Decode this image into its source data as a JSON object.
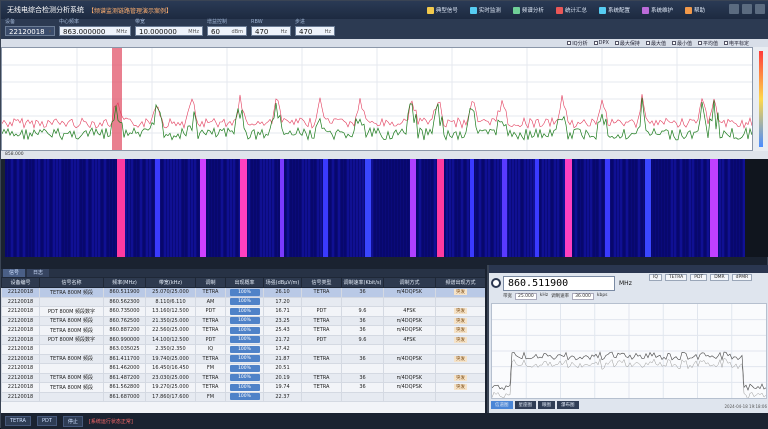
{
  "title": {
    "app_name": "无线电综合检测分析系统",
    "subtitle": "【频谱监测链路管理演示案例】"
  },
  "topnav": [
    {
      "label": "典型信号",
      "color": "#f2c94c"
    },
    {
      "label": "实时监测",
      "color": "#56ccf2"
    },
    {
      "label": "频谱分析",
      "color": "#6fcf97"
    },
    {
      "label": "统计汇总",
      "color": "#eb5757"
    },
    {
      "label": "系统配置",
      "color": "#56ccf2"
    },
    {
      "label": "系统维护",
      "color": "#bb6bd9"
    },
    {
      "label": "帮助",
      "color": "#f2994a"
    }
  ],
  "params": [
    {
      "label": "设备",
      "value": "22120018",
      "unit": ""
    },
    {
      "label": "中心频率",
      "value": "863.000000",
      "unit": "MHz"
    },
    {
      "label": "带宽",
      "value": "10.000000",
      "unit": "MHz"
    },
    {
      "label": "增益控制",
      "value": "60",
      "unit": "dBm"
    },
    {
      "label": "RBW",
      "value": "470",
      "unit": "Hz"
    },
    {
      "label": "步进",
      "value": "470",
      "unit": "Hz"
    }
  ],
  "spectrum_toolbar": [
    "IQ分析",
    "DPX",
    "最大保持",
    "最大值",
    "最小值",
    "平均值",
    "电平标定"
  ],
  "spectrum_foot": "858.000",
  "spectrum_marker": "860.511",
  "bottom_tabs": [
    "信号",
    "日志"
  ],
  "table": {
    "columns": [
      "设备编号",
      "信号名称",
      "频率(MHz)",
      "带宽(kHz)",
      "调制",
      "出现概率",
      "场强(dBμV/m)",
      "信号类型",
      "调制速率(Kbit/s)",
      "调制方式",
      "频谱出现方式"
    ],
    "rows": [
      [
        "22120018",
        "TETRA 800M 频段",
        "860.511900",
        "25.070/25.000",
        "TETRA",
        "100%",
        "26.10",
        "TETRA",
        "36",
        "π/4DQPSK",
        "突发"
      ],
      [
        "22120018",
        "",
        "860.562300",
        "8.110/6.110",
        "AM",
        "100%",
        "17.20",
        "",
        "",
        "",
        ""
      ],
      [
        "22120018",
        "PDT 800M 频段数字",
        "860.735000",
        "13.160/12.500",
        "PDT",
        "100%",
        "16.71",
        "PDT",
        "9.6",
        "4FSK",
        "突发"
      ],
      [
        "22120018",
        "TETRA 800M 频段",
        "860.762500",
        "21.350/25.000",
        "TETRA",
        "100%",
        "23.25",
        "TETRA",
        "36",
        "π/4DQPSK",
        "突发"
      ],
      [
        "22120018",
        "TETRA 800M 频段",
        "860.887200",
        "22.560/25.000",
        "TETRA",
        "100%",
        "25.43",
        "TETRA",
        "36",
        "π/4DQPSK",
        "突发"
      ],
      [
        "22120018",
        "PDT 800M 频段数字",
        "860.990000",
        "14.100/12.500",
        "PDT",
        "100%",
        "21.72",
        "PDT",
        "9.6",
        "4FSK",
        "突发"
      ],
      [
        "22120018",
        "",
        "863.035025",
        "2.350/2.350",
        "IQ",
        "100%",
        "17.42",
        "",
        "",
        "",
        ""
      ],
      [
        "22120018",
        "TETRA 800M 频段",
        "861.411700",
        "19.740/25.000",
        "TETRA",
        "100%",
        "21.87",
        "TETRA",
        "36",
        "π/4DQPSK",
        "突发"
      ],
      [
        "22120018",
        "",
        "861.462000",
        "16.450/16.450",
        "FM",
        "100%",
        "20.51",
        "",
        "",
        "",
        ""
      ],
      [
        "22120018",
        "TETRA 800M 频段",
        "861.487200",
        "23.030/25.000",
        "TETRA",
        "100%",
        "20.19",
        "TETRA",
        "36",
        "π/4DQPSK",
        "突发"
      ],
      [
        "22120018",
        "TETRA 800M 频段",
        "861.562800",
        "19.270/25.000",
        "TETRA",
        "100%",
        "19.74",
        "TETRA",
        "36",
        "π/4DQPSK",
        "突发"
      ],
      [
        "22120018",
        "",
        "861.687000",
        "17.860/17.600",
        "FM",
        "100%",
        "22.37",
        "",
        "",
        "",
        ""
      ]
    ]
  },
  "bottom_bar": {
    "items": [
      "TETRA",
      "PDT",
      "停止"
    ],
    "warning": "[系统运行状态正常]"
  },
  "detail": {
    "frequency": "860.511900",
    "unit": "MHz",
    "modes": [
      "IQ",
      "TETRA",
      "PDT",
      "DMR",
      "dPMR"
    ],
    "params": [
      "带宽",
      "25.000",
      "kHz",
      "调制速率",
      "36.000",
      "kbps"
    ],
    "tabs": [
      "信道图",
      "星座图",
      "眼图",
      "瀑布图"
    ],
    "status": "2024-04-18 19:18:06"
  },
  "colors": {
    "waterfall_bg": "#000060",
    "signal_line": "#1a7a1a",
    "max_line": "#e23a5a",
    "accent": "#4f82c8"
  }
}
